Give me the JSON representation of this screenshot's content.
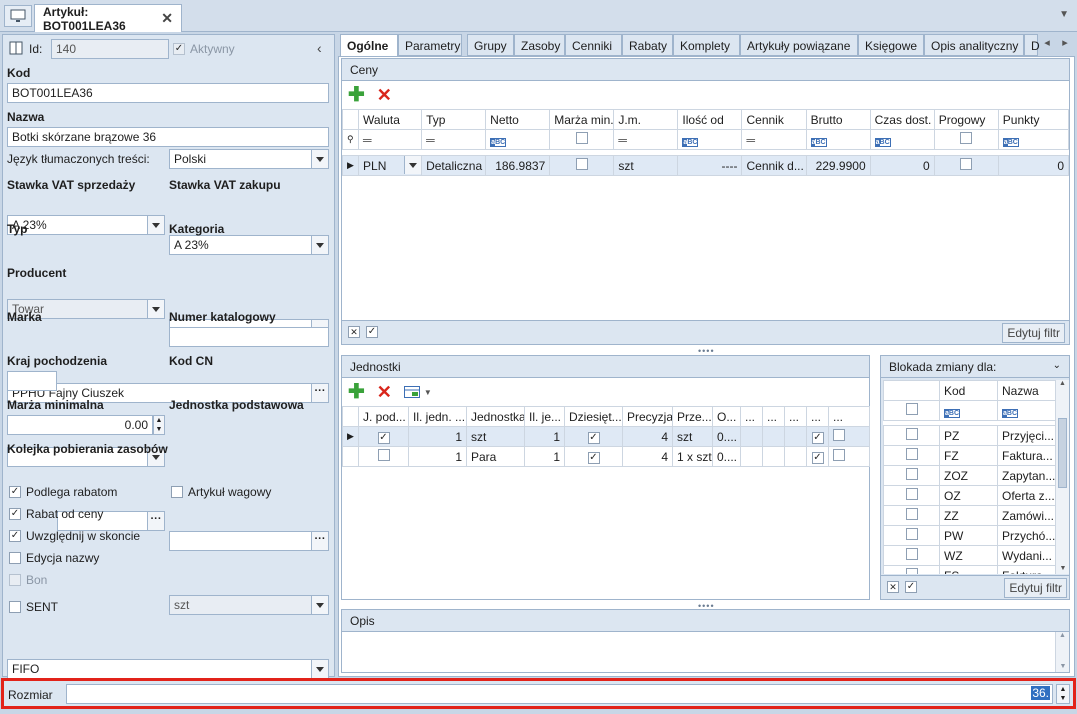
{
  "header": {
    "doc_tab_label": "Artykuł: BOT001LEA36"
  },
  "form": {
    "id_label": "Id:",
    "id_value": "140",
    "active_label": "Aktywny",
    "kod_label": "Kod",
    "kod_value": "BOT001LEA36",
    "nazwa_label": "Nazwa",
    "nazwa_value": "Botki skórzane brązowe 36",
    "lang_label": "Język tłumaczonych treści:",
    "lang_value": "Polski",
    "vat_sale_label": "Stawka VAT sprzedaży",
    "vat_sale_value": "A 23%",
    "vat_buy_label": "Stawka VAT zakupu",
    "vat_buy_value": "A 23%",
    "typ_label": "Typ",
    "typ_value": "Towar",
    "kategoria_label": "Kategoria",
    "kategoria_value": "",
    "producent_label": "Producent",
    "producent_value": "PPHU Fajny Ciuszek",
    "marka_label": "Marka",
    "marka_value": "",
    "nr_kat_label": "Numer katalogowy",
    "nr_kat_value": "",
    "kraj_label": "Kraj pochodzenia",
    "kod_cn_label": "Kod CN",
    "marza_label": "Marża minimalna",
    "marza_value": "0.00",
    "jedn_label": "Jednostka podstawowa",
    "jedn_value": "szt",
    "kolejka_label": "Kolejka pobierania zasobów",
    "kolejka_value": "FIFO",
    "checkboxes": [
      {
        "label": "Podlega rabatom",
        "checked": true
      },
      {
        "label": "Artykuł wagowy",
        "checked": false
      },
      {
        "label": "Rabat od ceny",
        "checked": true
      },
      {
        "label": "Uwzględnij w skoncie",
        "checked": true
      },
      {
        "label": "Edycja nazwy",
        "checked": false
      },
      {
        "label": "Bon",
        "checked": false
      },
      {
        "label": "SENT",
        "checked": false
      }
    ]
  },
  "tabs": [
    "Ogólne",
    "Parametry",
    "Grupy",
    "Zasoby",
    "Cenniki",
    "Rabaty",
    "Komplety",
    "Artykuły powiązane",
    "Księgowe",
    "Opis analityczny",
    "D"
  ],
  "ceny": {
    "title": "Ceny",
    "columns": [
      "Waluta",
      "Typ",
      "Netto",
      "Marża min.",
      "J.m.",
      "Ilość od",
      "Cennik",
      "Brutto",
      "Czas dost.",
      "Progowy",
      "Punkty"
    ],
    "row": {
      "waluta": "PLN",
      "typ": "Detaliczna",
      "netto": "186.9837",
      "jm": "szt",
      "ilosc_od": "----",
      "cennik": "Cennik d...",
      "brutto": "229.9900",
      "czas": "0",
      "punkty": "0"
    },
    "filter_btn": "Edytuj filtr"
  },
  "jednostki": {
    "title": "Jednostki",
    "columns": [
      "J. pod...",
      "Il. jedn. ...",
      "Jednostka",
      "Il. je...",
      "Dziesięt...",
      "Precyzja",
      "Prze...",
      "O...",
      "...",
      "...",
      "...",
      "...",
      "..."
    ],
    "rows": [
      {
        "il_jedn": "1",
        "jednostka": "szt",
        "il_je": "1",
        "precyzja": "4",
        "prze": "szt",
        "o": "0...."
      },
      {
        "il_jedn": "1",
        "jednostka": "Para",
        "il_je": "1",
        "precyzja": "4",
        "prze": "1 x szt",
        "o": "0...."
      }
    ]
  },
  "blokada": {
    "title": "Blokada zmiany dla:",
    "columns": [
      "Kod",
      "Nazwa"
    ],
    "rows": [
      {
        "kod": "PZ",
        "nazwa": "Przyjęci..."
      },
      {
        "kod": "FZ",
        "nazwa": "Faktura..."
      },
      {
        "kod": "ZOZ",
        "nazwa": "Zapytan..."
      },
      {
        "kod": "OZ",
        "nazwa": "Oferta z..."
      },
      {
        "kod": "ZZ",
        "nazwa": "Zamówi..."
      },
      {
        "kod": "PW",
        "nazwa": "Przychó..."
      },
      {
        "kod": "WZ",
        "nazwa": "Wydani..."
      },
      {
        "kod": "FS",
        "nazwa": "Faktura..."
      }
    ],
    "filter_btn": "Edytuj filtr"
  },
  "opis": {
    "title": "Opis"
  },
  "bottom": {
    "rozmiar_label": "Rozmiar",
    "rozmiar_value": "36."
  },
  "colors": {
    "accent_red": "#e2231a",
    "panel_bg": "#dce6f1",
    "border": "#9fb4cc"
  }
}
